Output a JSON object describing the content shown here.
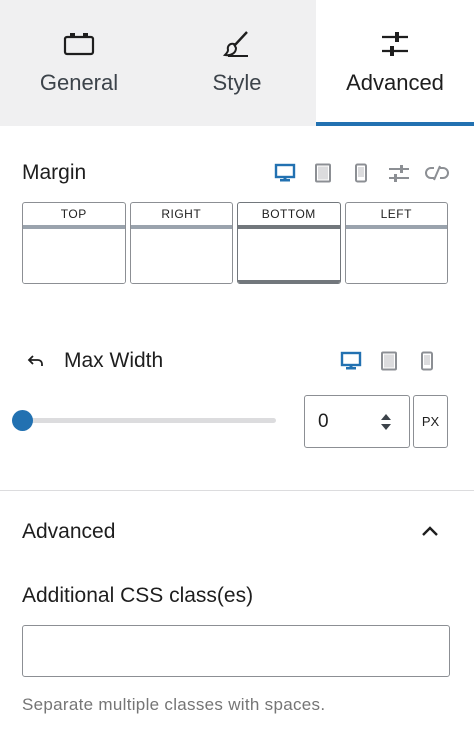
{
  "tabs": [
    {
      "label": "General",
      "icon": "block-icon",
      "active": false
    },
    {
      "label": "Style",
      "icon": "brush-icon",
      "active": false
    },
    {
      "label": "Advanced",
      "icon": "sliders-icon",
      "active": true
    }
  ],
  "margin": {
    "label": "Margin",
    "sides": [
      {
        "label": "TOP",
        "value": ""
      },
      {
        "label": "RIGHT",
        "value": ""
      },
      {
        "label": "BOTTOM",
        "value": ""
      },
      {
        "label": "LEFT",
        "value": ""
      }
    ]
  },
  "max_width": {
    "label": "Max Width",
    "value": "0",
    "unit": "PX",
    "slider_fraction": 0
  },
  "advanced": {
    "title": "Advanced",
    "css_label": "Additional CSS class(es)",
    "css_value": "",
    "help": "Separate multiple classes with spaces."
  },
  "colors": {
    "accent": "#2271b1",
    "icon_gray": "#8c8f94",
    "tab_bg": "#f0f0f1"
  }
}
